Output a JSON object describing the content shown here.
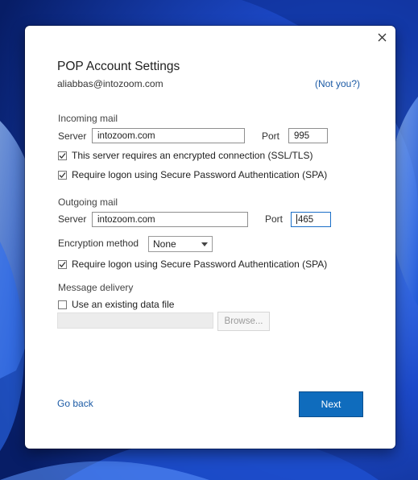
{
  "dialog": {
    "title": "POP Account Settings",
    "email": "aliabbas@intozoom.com",
    "not_you": "(Not you?)"
  },
  "incoming": {
    "section": "Incoming mail",
    "server_label": "Server",
    "server_value": "intozoom.com",
    "port_label": "Port",
    "port_value": "995",
    "ssl_label": "This server requires an encrypted connection (SSL/TLS)",
    "ssl_checked": true,
    "spa_label": "Require logon using Secure Password Authentication (SPA)",
    "spa_checked": true
  },
  "outgoing": {
    "section": "Outgoing mail",
    "server_label": "Server",
    "server_value": "intozoom.com",
    "port_label": "Port",
    "port_value": "465",
    "encryption_label": "Encryption method",
    "encryption_value": "None",
    "spa_label": "Require logon using Secure Password Authentication (SPA)",
    "spa_checked": true
  },
  "delivery": {
    "section": "Message delivery",
    "existing_label": "Use an existing data file",
    "existing_checked": false,
    "browse_label": "Browse..."
  },
  "footer": {
    "go_back": "Go back",
    "next": "Next"
  },
  "colors": {
    "accent": "#0f6cbd",
    "link": "#1b5aa5",
    "wallpaper": "#0a2a8a"
  }
}
